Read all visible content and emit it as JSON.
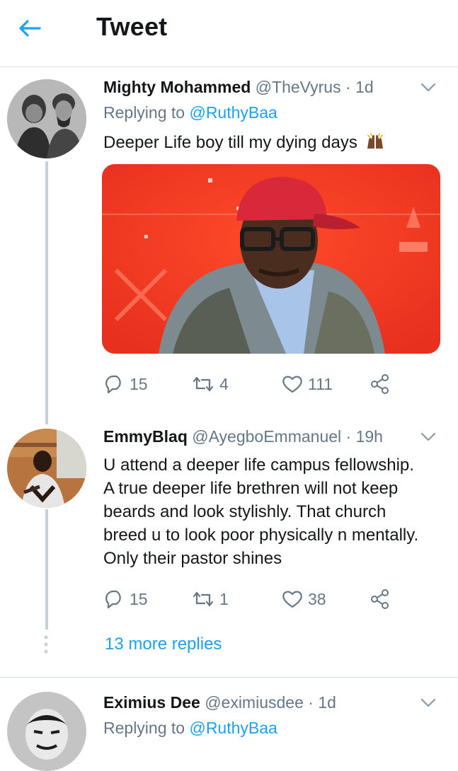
{
  "header": {
    "title": "Tweet"
  },
  "tweets": [
    {
      "name": "Mighty Mohammed",
      "handle": "@TheVyrus",
      "sep": "·",
      "time": "1d",
      "replying_prefix": "Replying to ",
      "replying_to": "@RuthyBaa",
      "text": "Deeper Life boy till my dying days",
      "emoji": "raised-hands-emoji",
      "stats": {
        "replies": "15",
        "retweets": "4",
        "likes": "111"
      }
    },
    {
      "name": "EmmyBlaq",
      "handle": "@AyegboEmmanuel",
      "sep": "·",
      "time": "19h",
      "lines": [
        "U attend a deeper life campus fellowship.",
        "A true deeper life brethren will not keep",
        "beards and look stylishly. That church",
        "breed u to look poor physically n mentally.",
        "Only their pastor shines"
      ],
      "stats": {
        "replies": "15",
        "retweets": "1",
        "likes": "38"
      },
      "more_replies": "13 more replies"
    },
    {
      "name": "Eximius Dee",
      "handle": "@eximiusdee",
      "sep": "·",
      "time": "1d",
      "replying_prefix": "Replying to ",
      "replying_to": "@RuthyBaa"
    }
  ],
  "colors": {
    "accent": "#1da1f2",
    "muted": "#657786",
    "text": "#14171a",
    "divider": "#d8dde2"
  },
  "icons": [
    "back-arrow-icon",
    "chevron-down-icon",
    "reply-icon",
    "retweet-icon",
    "like-icon",
    "share-icon"
  ]
}
